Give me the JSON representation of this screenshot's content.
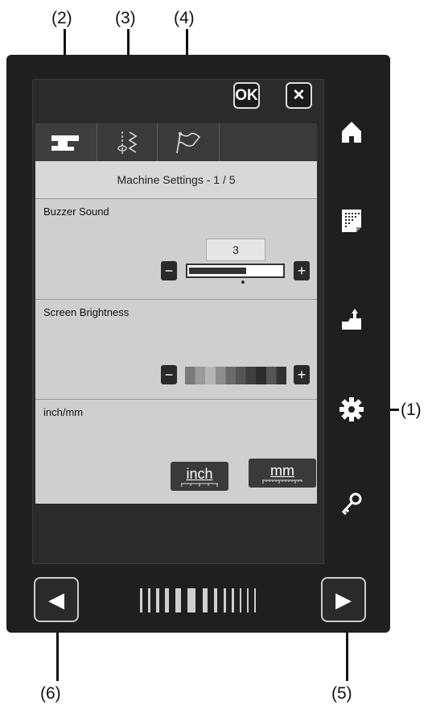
{
  "callouts": {
    "c1": "(1)",
    "c2": "(2)",
    "c3": "(3)",
    "c4": "(4)",
    "c5": "(5)",
    "c6": "(6)"
  },
  "top_buttons": {
    "ok_label": "OK",
    "close_label": "✕"
  },
  "header": {
    "title": "Machine Settings - 1 / 5"
  },
  "buzzer": {
    "label": "Buzzer Sound",
    "value": "3",
    "minus": "−",
    "plus": "+",
    "level": 0.6
  },
  "brightness": {
    "label": "Screen Brightness",
    "minus": "−",
    "plus": "+"
  },
  "units": {
    "label": "inch/mm",
    "inch": "inch",
    "mm": "mm"
  },
  "side_icons": [
    "home-icon",
    "pattern-icon",
    "export-icon",
    "gear-icon",
    "key-icon"
  ],
  "nav": {
    "prev": "◀",
    "next": "▶"
  }
}
